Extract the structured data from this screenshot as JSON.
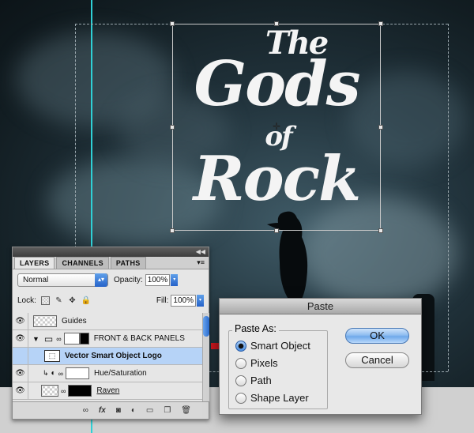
{
  "canvas": {
    "logo_lines": [
      "The",
      "Gods",
      "of",
      "Rock"
    ]
  },
  "layers_panel": {
    "tabs": [
      {
        "label": "LAYERS",
        "active": true
      },
      {
        "label": "CHANNELS",
        "active": false
      },
      {
        "label": "PATHS",
        "active": false
      }
    ],
    "blend_mode": "Normal",
    "opacity_label": "Opacity:",
    "opacity_value": "100%",
    "lock_label": "Lock:",
    "fill_label": "Fill:",
    "fill_value": "100%",
    "layers": [
      {
        "name": "Guides",
        "visible": true,
        "selected": false
      },
      {
        "name": "FRONT & BACK PANELS",
        "visible": true,
        "selected": false,
        "group": true
      },
      {
        "name": "Vector Smart Object Logo",
        "visible": false,
        "selected": true
      },
      {
        "name": "Hue/Saturation",
        "visible": true,
        "selected": false
      },
      {
        "name": "Raven",
        "visible": true,
        "selected": false
      }
    ]
  },
  "paste_dialog": {
    "title": "Paste",
    "group_label": "Paste As:",
    "options": [
      {
        "label": "Smart Object",
        "checked": true
      },
      {
        "label": "Pixels",
        "checked": false
      },
      {
        "label": "Path",
        "checked": false
      },
      {
        "label": "Shape Layer",
        "checked": false
      }
    ],
    "ok_label": "OK",
    "cancel_label": "Cancel"
  },
  "colors": {
    "guide": "#2fd0d6",
    "selection_highlight": "#b6d3f7",
    "arrow": "#c8161d"
  }
}
